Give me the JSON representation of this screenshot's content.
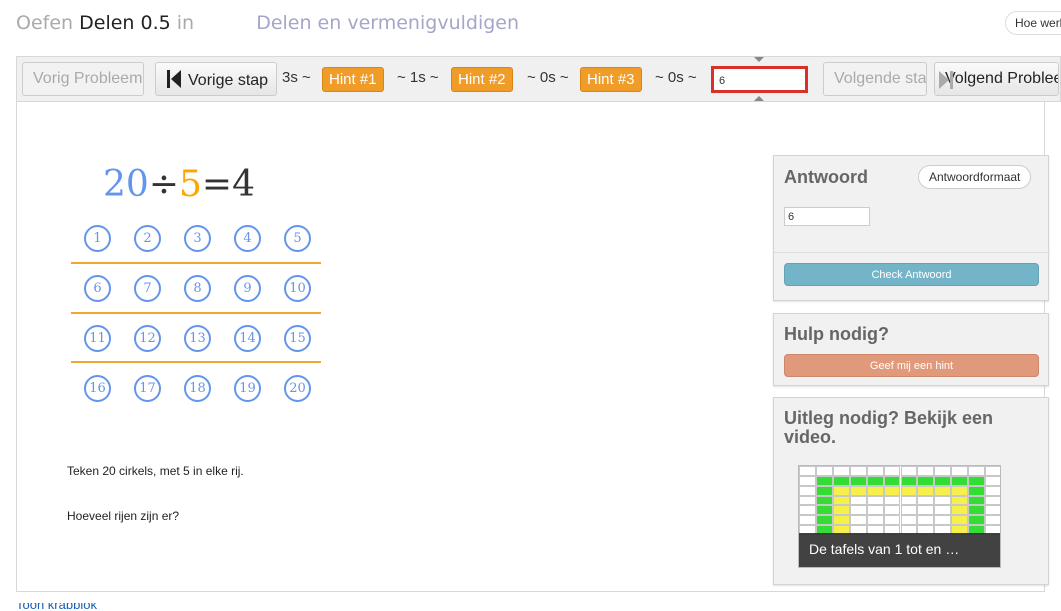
{
  "breadcrumb": {
    "prefix": "Oefen",
    "exercise": "Delen 0.5",
    "in_word": "in",
    "topic": "Delen en vermenigvuldigen"
  },
  "header": {
    "help_button": "Hoe werkt dit?"
  },
  "toolbar": {
    "prev_problem": "Vorig Probleem",
    "prev_step": "Vorige stap",
    "time_0": "3s ~",
    "hint1": "Hint #1",
    "time_1": "~ 1s ~",
    "hint2": "Hint #2",
    "time_2": "~ 0s ~",
    "hint3": "Hint #3",
    "time_3": "~ 0s ~",
    "replay_value": "6",
    "next_step": "Volgende stap",
    "next_problem": "Volgend Probleem"
  },
  "problem": {
    "equation": {
      "dividend": "20",
      "operator": "÷",
      "divisor": "5",
      "equals": "=",
      "quotient": "4"
    },
    "circles": [
      "1",
      "2",
      "3",
      "4",
      "5",
      "6",
      "7",
      "8",
      "9",
      "10",
      "11",
      "12",
      "13",
      "14",
      "15",
      "16",
      "17",
      "18",
      "19",
      "20"
    ],
    "instruction": "Teken 20 cirkels, met 5 in elke rij.",
    "question": "Hoeveel rijen zijn er?"
  },
  "answer_panel": {
    "title": "Antwoord",
    "format_button": "Antwoordformaat",
    "value": "6",
    "check_button": "Check Antwoord"
  },
  "help_panel": {
    "title": "Hulp nodig?",
    "hint_button": "Geef mij een hint"
  },
  "video_panel": {
    "title": "Uitleg nodig? Bekijk een video.",
    "video_title": "De tafels van 1 tot en …"
  },
  "footer": {
    "link": "Toon krabblok"
  },
  "colors": {
    "blue": "#6495ed",
    "orange": "#ffa500",
    "hint": "#f09c29",
    "check": "#73b4c8",
    "hint_button": "#e0997a",
    "replay_border": "#d9302a"
  }
}
